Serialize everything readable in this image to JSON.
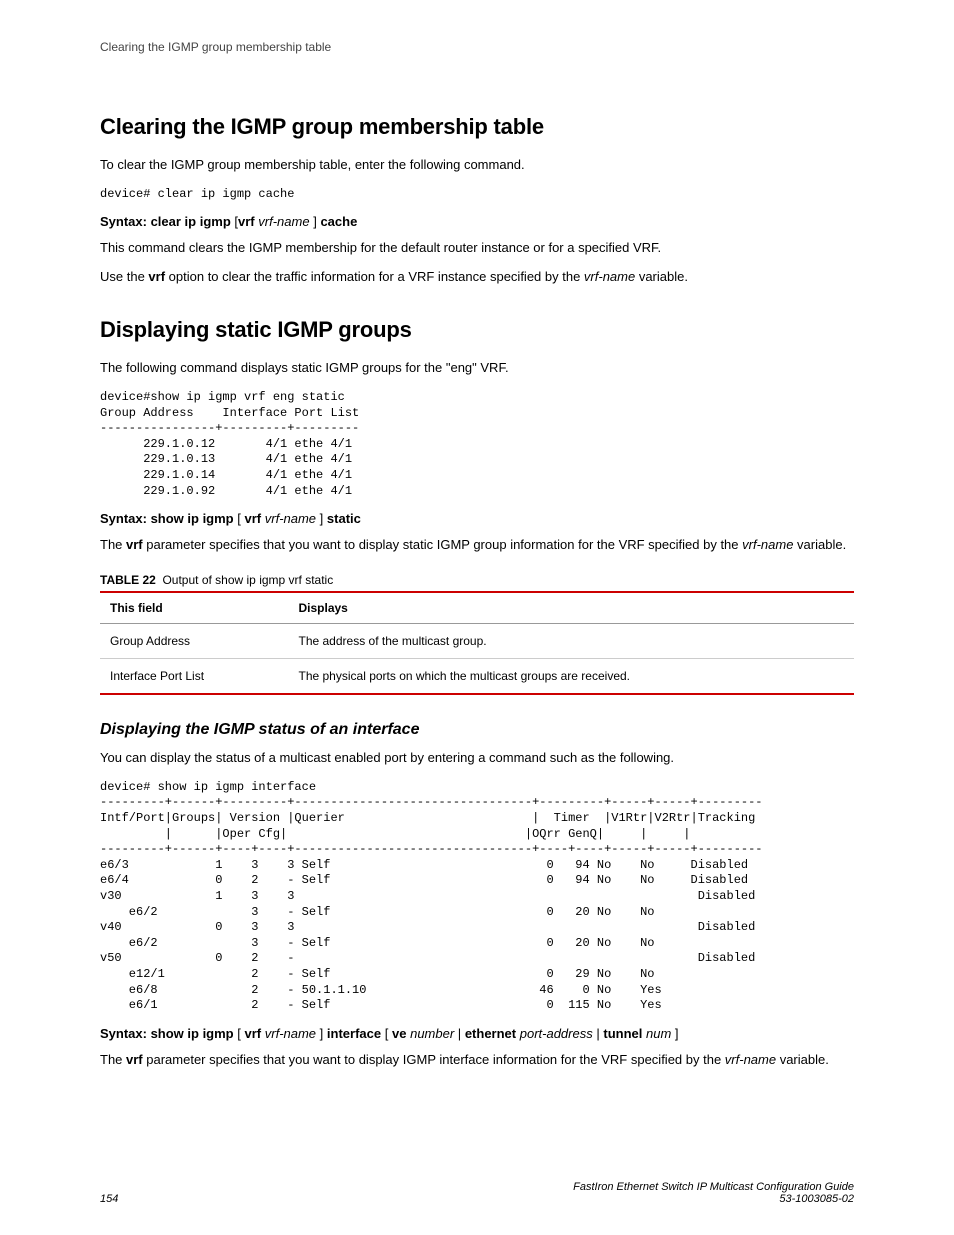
{
  "header": {
    "running": "Clearing the IGMP group membership table"
  },
  "sec1": {
    "title": "Clearing the IGMP group membership table",
    "intro": "To clear the IGMP group membership table, enter the following command.",
    "cli": "device# clear ip igmp cache",
    "syntax": {
      "prefix": "Syntax: clear ip igmp",
      "lb": "[",
      "kw_vrf": "vrf",
      "var_vrf": "vrf-name",
      "rb": "]",
      "suffix": "cache"
    },
    "desc1": "This command clears the IGMP membership for the default router instance or for a specified VRF.",
    "desc2a": "Use the ",
    "desc2_vrf": "vrf",
    "desc2b": " option to clear the traffic information for a VRF instance specified by the ",
    "desc2_var": "vrf-name",
    "desc2c": " variable."
  },
  "sec2": {
    "title": "Displaying static IGMP groups",
    "intro": "The following command displays static IGMP groups for the \"eng\" VRF.",
    "cli": "device#show ip igmp vrf eng static\nGroup Address    Interface Port List\n----------------+---------+---------\n      229.1.0.12       4/1 ethe 4/1\n      229.1.0.13       4/1 ethe 4/1\n      229.1.0.14       4/1 ethe 4/1\n      229.1.0.92       4/1 ethe 4/1",
    "syntax": {
      "prefix": "Syntax: show ip igmp",
      "lb": "[",
      "kw_vrf": "vrf",
      "var_vrf": "vrf-name",
      "rb": "]",
      "suffix": "static"
    },
    "desc1a": "The ",
    "desc1_vrf": "vrf",
    "desc1b": " parameter specifies that you want to display static IGMP group information for the VRF specified by the ",
    "desc1_var": "vrf-name",
    "desc1c": " variable.",
    "table_label": "TABLE 22",
    "table_caption": "Output of show ip igmp vrf static",
    "th1": "This field",
    "th2": "Displays",
    "row1": {
      "f": "Group Address",
      "d": "The address of the multicast group."
    },
    "row2": {
      "f": "Interface Port List",
      "d": "The physical ports on which the multicast groups are received."
    }
  },
  "sec3": {
    "title": "Displaying the IGMP status of an interface",
    "intro": "You can display the status of a multicast enabled port by entering a command such as the following.",
    "cli": "device# show ip igmp interface\n---------+------+---------+---------------------------------+---------+-----+-----+---------\nIntf/Port|Groups| Version |Querier                          |  Timer  |V1Rtr|V2Rtr|Tracking\n         |      |Oper Cfg|                                 |OQrr GenQ|     |     |\n---------+------+----+----+---------------------------------+----+----+-----+-----+---------\ne6/3            1    3    3 Self                              0   94 No    No     Disabled\ne6/4            0    2    - Self                              0   94 No    No     Disabled\nv30             1    3    3                                                        Disabled\n    e6/2             3    - Self                              0   20 No    No\nv40             0    3    3                                                        Disabled\n    e6/2             3    - Self                              0   20 No    No\nv50             0    2    -                                                        Disabled\n    e12/1            2    - Self                              0   29 No    No\n    e6/8             2    - 50.1.1.10                        46    0 No    Yes\n    e6/1             2    - Self                              0  115 No    Yes",
    "syntax": {
      "prefix": "Syntax: show ip igmp",
      "lb1": "[",
      "kw_vrf": "vrf",
      "var_vrf": "vrf-name",
      "rb1": "]",
      "kw_iface": "interface",
      "lb2": "[",
      "kw_ve": "ve",
      "var_num": "number",
      "pipe1": "|",
      "kw_eth": "ethernet",
      "var_port": "port-address",
      "pipe2": "|",
      "kw_tun": "tunnel",
      "var_tnum": "num",
      "rb2": "]"
    },
    "desc1a": "The ",
    "desc1_vrf": "vrf",
    "desc1b": " parameter specifies that you want to display IGMP interface information for the VRF specified by the ",
    "desc1_var": "vrf-name",
    "desc1c": " variable."
  },
  "footer": {
    "page": "154",
    "title": "FastIron Ethernet Switch IP Multicast Configuration Guide",
    "docnum": "53-1003085-02"
  }
}
